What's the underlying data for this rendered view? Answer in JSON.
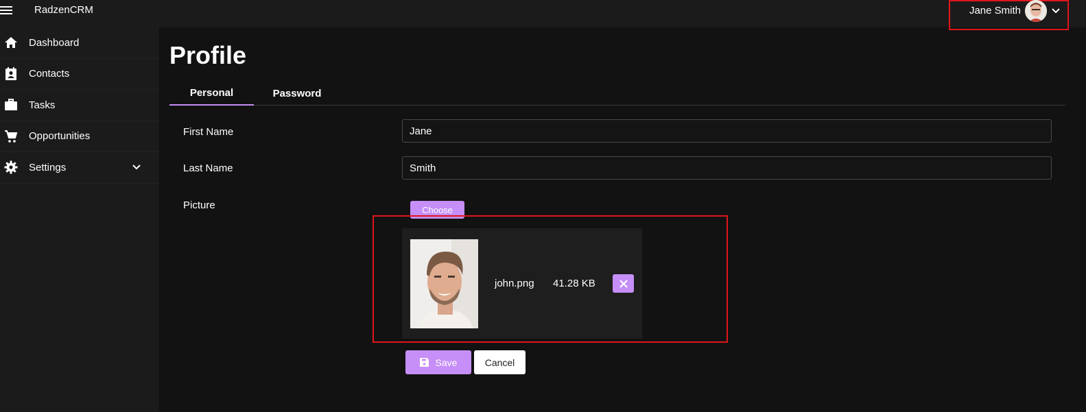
{
  "header": {
    "brand": "RadzenCRM",
    "user_name": "Jane Smith"
  },
  "sidebar": {
    "items": [
      {
        "label": "Dashboard",
        "icon": "home-icon"
      },
      {
        "label": "Contacts",
        "icon": "contacts-icon"
      },
      {
        "label": "Tasks",
        "icon": "briefcase-icon"
      },
      {
        "label": "Opportunities",
        "icon": "cart-icon"
      },
      {
        "label": "Settings",
        "icon": "gear-icon"
      }
    ]
  },
  "main": {
    "title": "Profile",
    "tabs": [
      {
        "label": "Personal",
        "selected": true
      },
      {
        "label": "Password",
        "selected": false
      }
    ],
    "form": {
      "first_name_label": "First Name",
      "first_name_value": "Jane",
      "last_name_label": "Last Name",
      "last_name_value": "Smith",
      "picture_label": "Picture",
      "choose_label": "Choose",
      "file": {
        "name": "john.png",
        "size": "41.28 KB"
      },
      "save_label": "Save",
      "cancel_label": "Cancel"
    }
  },
  "colors": {
    "accent": "#c68ef7",
    "background": "#121212",
    "panel": "#1b1b1b",
    "highlight": "#e0151a"
  }
}
